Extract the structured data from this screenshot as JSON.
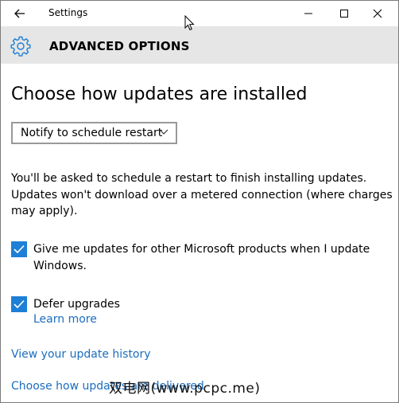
{
  "titlebar": {
    "title": "Settings",
    "back_icon": "back-arrow-icon",
    "minimize_icon": "minimize-icon",
    "maximize_icon": "maximize-icon",
    "close_icon": "close-icon"
  },
  "header": {
    "icon": "gear-icon",
    "title": "ADVANCED OPTIONS"
  },
  "page_title": "Choose how updates are installed",
  "dropdown": {
    "selected": "Notify to schedule restart"
  },
  "description": "You'll be asked to schedule a restart to finish installing updates. Updates won't download over a metered connection (where charges may apply).",
  "options": [
    {
      "label": "Give me updates for other Microsoft products when I update Windows.",
      "checked": true
    },
    {
      "label": "Defer upgrades",
      "checked": true
    }
  ],
  "links": {
    "learn_more": "Learn more",
    "update_history": "View your update history",
    "choose_how_partial": "Choose how updates are delivered"
  },
  "watermark": "双电网(www.pcpc.me)",
  "colors": {
    "accent": "#1e7fd6",
    "link": "#1a6dbf",
    "header_bg": "#e6e6e6"
  }
}
